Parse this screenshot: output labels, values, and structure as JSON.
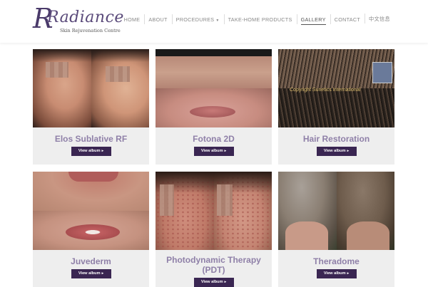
{
  "brand": {
    "name": "Radiance",
    "tagline": "Skin Rejuvenation Centre"
  },
  "nav": {
    "items": [
      {
        "label": "HOME",
        "active": false
      },
      {
        "label": "ABOUT",
        "active": false
      },
      {
        "label": "PROCEDURES",
        "active": false,
        "has_dropdown": true
      },
      {
        "label": "TAKE-HOME PRODUCTS",
        "active": false
      },
      {
        "label": "GALLERY",
        "active": true
      },
      {
        "label": "CONTACT",
        "active": false
      },
      {
        "label": "中文信息",
        "active": false
      }
    ],
    "dropdown_icon": "caret-down-icon"
  },
  "gallery": {
    "button_label": "View album",
    "button_icon": "chevron-right-icon",
    "cards": [
      {
        "title": "Elos Sublative RF"
      },
      {
        "title": "Fotona 2D"
      },
      {
        "title": "Hair Restoration",
        "photo_caption": "Copyright Sunetics International"
      },
      {
        "title": "Juvederm"
      },
      {
        "title": "Photodynamic Therapy (PDT)"
      },
      {
        "title": "Theradome"
      }
    ]
  },
  "colors": {
    "brand_purple": "#3a2652",
    "title_purple": "#8f80a8",
    "card_bg": "#eeeeee",
    "nav_text": "#888888"
  }
}
